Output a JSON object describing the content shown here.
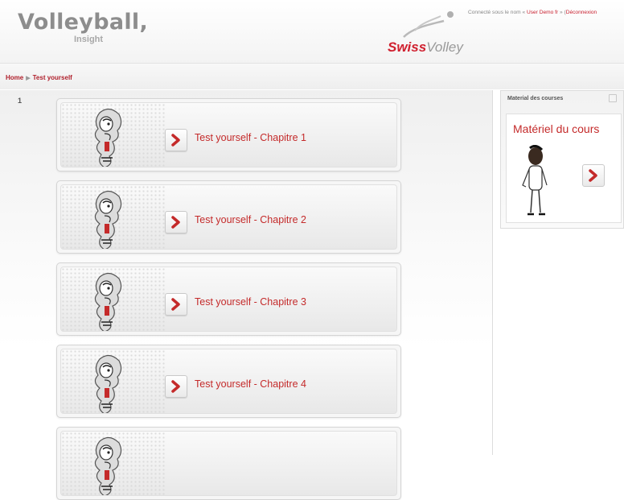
{
  "header": {
    "brand_title": "Volleyball,",
    "brand_subtitle": "Insight",
    "logo_swiss": "Swiss",
    "logo_volley": "Volley",
    "user_prefix": "Connecté sous le nom « ",
    "user_name": "User Demo fr",
    "user_mid": " » (",
    "logout": "Déconnexion"
  },
  "breadcrumb": {
    "home": "Home",
    "separator": "▶",
    "current": "Test yourself"
  },
  "main": {
    "section_number": "1",
    "cards": [
      {
        "title": "Test yourself - Chapitre 1"
      },
      {
        "title": "Test yourself - Chapitre 2"
      },
      {
        "title": "Test yourself - Chapitre 3"
      },
      {
        "title": "Test yourself - Chapitre 4"
      },
      {
        "title": ""
      }
    ]
  },
  "sidebar": {
    "block_title": "Material des courses",
    "card_title": "Matériel du cours"
  },
  "colors": {
    "accent": "#c42a2a",
    "brand_grey": "#8d8d8d"
  }
}
